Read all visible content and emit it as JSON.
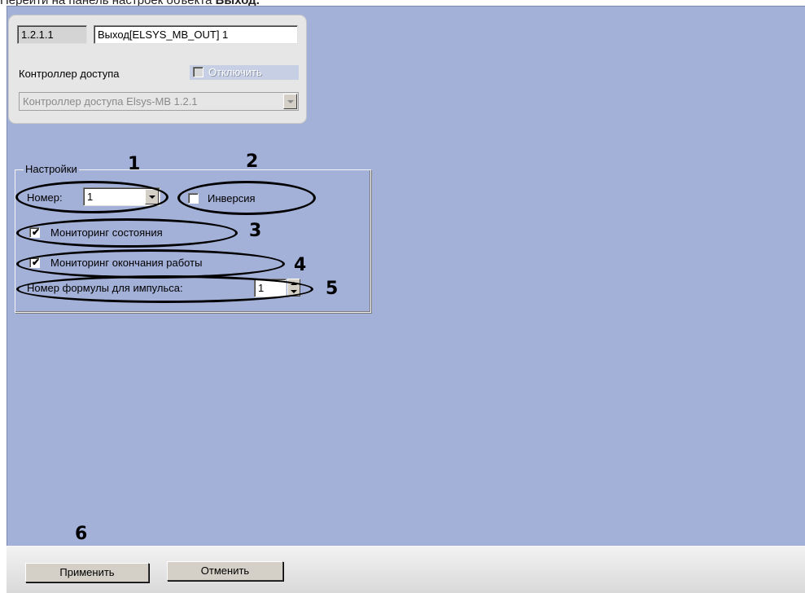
{
  "doc": {
    "intro": "Перейти на панель настроек объекта ",
    "intro_bold": "Выход",
    "intro_end": "."
  },
  "object": {
    "id": "1.2.1.1",
    "name": "Выход[ELSYS_MB_OUT] 1",
    "parent_label": "Контроллер доступа",
    "disable_label": "Отключить",
    "disable_checked": false,
    "parent_value": "Контроллер доступа Elsys-MB 1.2.1"
  },
  "settings": {
    "title": "Настройки",
    "number_label": "Номер:",
    "number_value": "1",
    "inversion_label": "Инверсия",
    "inversion_checked": false,
    "monitor_state_label": "Мониторинг состояния",
    "monitor_state_checked": true,
    "monitor_end_label": "Мониторинг окончания работы",
    "monitor_end_checked": true,
    "formula_label": "Номер формулы для импульса:",
    "formula_value": "1"
  },
  "callouts": [
    "1",
    "2",
    "3",
    "4",
    "5",
    "6"
  ],
  "buttons": {
    "apply": "Применить",
    "cancel": "Отменить"
  },
  "colors": {
    "panel_bg": "#a3b0d8",
    "card_bg": "#e6e6e6",
    "button_face": "#d4d0c8"
  },
  "icons": {
    "check": "✔"
  }
}
